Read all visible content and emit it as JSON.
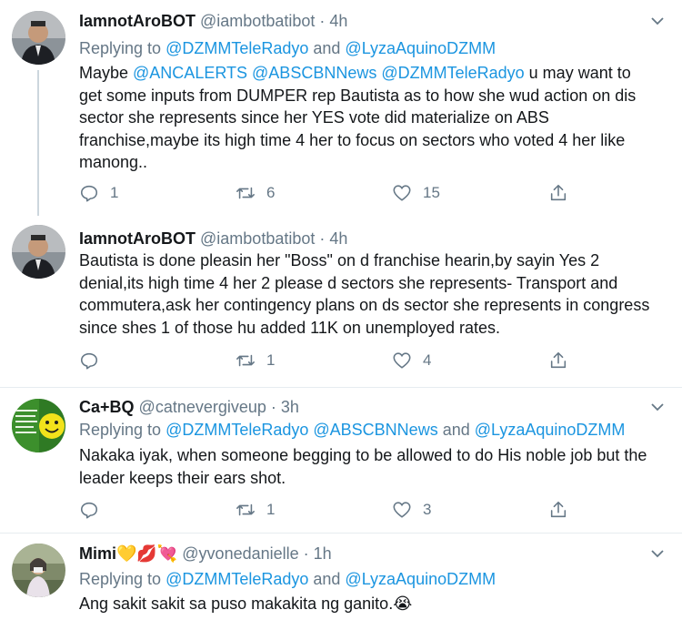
{
  "tweets": [
    {
      "name": "IamnotAroBOT",
      "name_emoji": "",
      "handle": "@iambotbatibot",
      "time": "4h",
      "replying_prefix": "Replying to ",
      "replying_to": [
        "@DZMMTeleRadyo",
        "@LyzaAquinoDZMM"
      ],
      "text_html_parts": [
        {
          "t": "Maybe ",
          "m": false
        },
        {
          "t": "@ANCALERTS",
          "m": true
        },
        {
          "t": " ",
          "m": false
        },
        {
          "t": "@ABSCBNNews",
          "m": true
        },
        {
          "t": " ",
          "m": false
        },
        {
          "t": "@DZMMTeleRadyo",
          "m": true
        },
        {
          "t": " u may want to get some inputs from DUMPER rep Bautista as to how she wud action on dis sector she represents since her YES vote did materialize on ABS franchise,maybe its high time 4 her to focus on sectors who voted 4 her like manong..",
          "m": false
        }
      ],
      "replies": "1",
      "retweets": "6",
      "likes": "15"
    },
    {
      "name": "IamnotAroBOT",
      "name_emoji": "",
      "handle": "@iambotbatibot",
      "time": "4h",
      "replying_prefix": "",
      "replying_to": [],
      "text_html_parts": [
        {
          "t": "Bautista is done pleasin her \"Boss\" on d franchise hearin,by sayin Yes 2 denial,its high time 4 her 2 please d sectors she represents- Transport and commutera,ask her contingency plans on ds sector she represents in congress since shes 1 of those hu added 11K on unemployed rates.",
          "m": false
        }
      ],
      "replies": "",
      "retweets": "1",
      "likes": "4"
    },
    {
      "name": "Ca+BQ",
      "name_emoji": "",
      "handle": "@catnevergiveup",
      "time": "3h",
      "replying_prefix": "Replying to ",
      "replying_to": [
        "@DZMMTeleRadyo",
        "@ABSCBNNews",
        "@LyzaAquinoDZMM"
      ],
      "text_html_parts": [
        {
          "t": "Nakaka iyak,  when someone begging to be allowed to do His noble job but the leader keeps their ears shot.",
          "m": false
        }
      ],
      "replies": "",
      "retweets": "1",
      "likes": "3"
    },
    {
      "name": "Mimi",
      "name_emoji": "💛💋💘",
      "handle": "@yvonedanielle",
      "time": "1h",
      "replying_prefix": "Replying to ",
      "replying_to": [
        "@DZMMTeleRadyo",
        "@LyzaAquinoDZMM"
      ],
      "text_html_parts": [
        {
          "t": "Ang sakit sakit sa puso makakita ng ganito.😭",
          "m": false
        }
      ],
      "replies": "",
      "retweets": "",
      "likes": ""
    }
  ],
  "labels": {
    "and": " and ",
    "dot": " · ",
    "space": " "
  },
  "icons": {
    "reply": "reply-icon",
    "retweet": "retweet-icon",
    "like": "heart-icon",
    "share": "share-icon",
    "more": "chevron-down-icon"
  },
  "colors": {
    "link": "#1b95e0",
    "secondary": "#657786",
    "text": "#14171a"
  }
}
